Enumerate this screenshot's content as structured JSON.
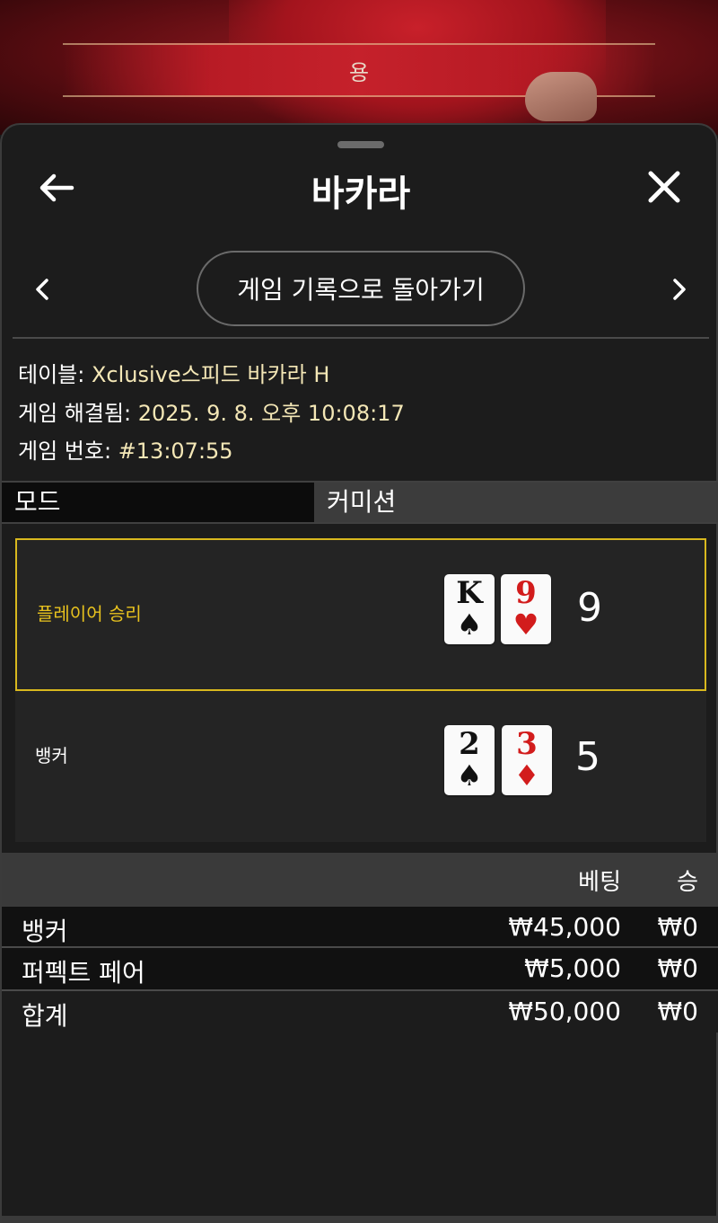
{
  "background": {
    "banner_text": "용"
  },
  "header": {
    "title": "바카라"
  },
  "navigation": {
    "return_button_label": "게임 기록으로 돌아가기"
  },
  "info": {
    "table_label": "테이블: ",
    "table_value": "Xclusive스피드 바카라 H",
    "resolved_label": "게임 해결됨: ",
    "resolved_value": "2025. 9. 8. 오후 10:08:17",
    "game_number_label": "게임 번호: ",
    "game_number_value": "#13:07:55"
  },
  "mode": {
    "label": "모드",
    "value": "커미션"
  },
  "hands": [
    {
      "label": "플레이어 승리",
      "label_color": "#e8c21e",
      "winner": true,
      "cards": [
        {
          "rank": "K",
          "suit": "♠",
          "color": "black"
        },
        {
          "rank": "9",
          "suit": "♥",
          "color": "red"
        }
      ],
      "score": "9"
    },
    {
      "label": "뱅커",
      "label_color": "#ffffff",
      "winner": false,
      "cards": [
        {
          "rank": "2",
          "suit": "♠",
          "color": "black"
        },
        {
          "rank": "3",
          "suit": "♦",
          "color": "red"
        }
      ],
      "score": "5"
    }
  ],
  "bets_table": {
    "headers": {
      "bet": "베팅",
      "win": "승"
    },
    "rows": [
      {
        "name": "뱅커",
        "bet": "₩45,000",
        "win": "₩0"
      },
      {
        "name": "퍼펙트 페어",
        "bet": "₩5,000",
        "win": "₩0"
      },
      {
        "name": "합계",
        "bet": "₩50,000",
        "win": "₩0"
      }
    ]
  },
  "colors": {
    "accent_gold": "#d8b81e",
    "info_value": "#f4e7b6"
  }
}
